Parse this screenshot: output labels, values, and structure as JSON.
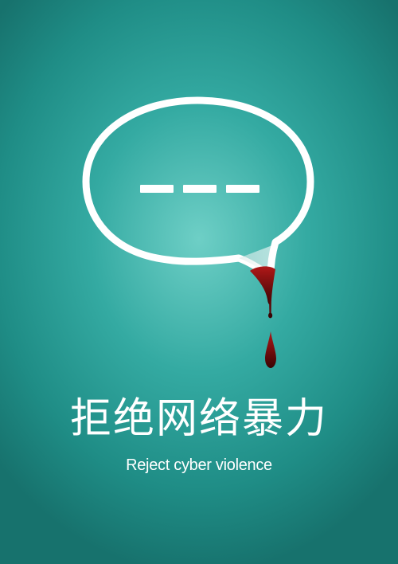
{
  "poster": {
    "title_zh": "拒绝网络暴力",
    "title_en": "Reject cyber violence"
  },
  "icons": {
    "bubble": "speech-bubble-icon",
    "ellipsis": "ellipsis-dashes-icon",
    "blood": "blood-drop-icon"
  },
  "colors": {
    "background_center": "#6ecfc6",
    "background_edge": "#17726d",
    "bubble": "#ffffff",
    "blood": "#8b0f0f"
  }
}
